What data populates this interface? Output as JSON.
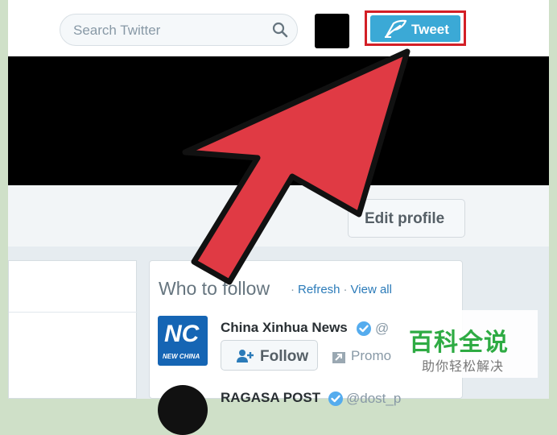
{
  "header": {
    "search_placeholder": "Search Twitter",
    "tweet_label": "Tweet"
  },
  "profile": {
    "edit_profile_label": "Edit profile"
  },
  "who_to_follow": {
    "title": "Who to follow",
    "refresh_label": "Refresh",
    "separator": "·",
    "view_all_label": "View all",
    "accounts": [
      {
        "name": "China Xinhua News",
        "handle": "@",
        "follow_label": "Follow",
        "promo_label": "Promo",
        "logo_text": "NC",
        "logo_subtext": "NEW CHINA"
      },
      {
        "name": "RAGASA POST",
        "handle": "@dost_p"
      }
    ]
  },
  "watermark": {
    "main": "百科全说",
    "sub": "助你轻松解决"
  },
  "colors": {
    "tweet_button": "#3ba9d6",
    "highlight_outline": "#d31f26",
    "arrow_fill": "#e03a44",
    "link": "#2b7bb9",
    "verified": "#55acee",
    "watermark_green": "#2eab43"
  }
}
